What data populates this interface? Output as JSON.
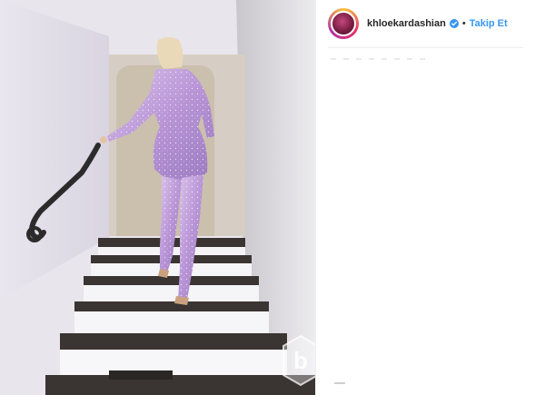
{
  "post": {
    "username": "khloekardashian",
    "separator": "•",
    "follow_label": "Takip Et"
  },
  "icons": {
    "verified": "verified-badge-icon",
    "watermark": "watermark-logo-icon"
  },
  "colors": {
    "follow": "#3897f0",
    "verified": "#3897f0",
    "username": "#262626"
  }
}
